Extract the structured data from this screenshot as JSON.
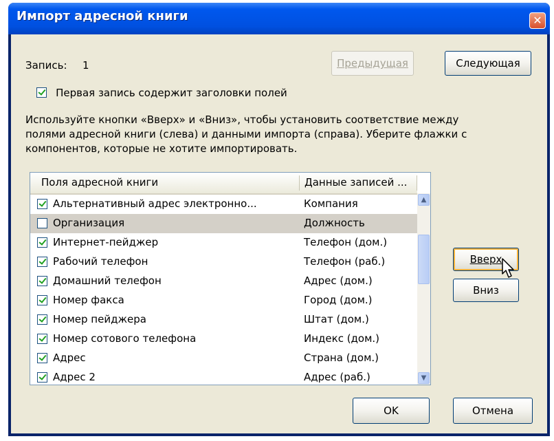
{
  "window": {
    "title": "Импорт адресной книги",
    "close": "✕"
  },
  "record": {
    "label": "Запись:",
    "value": "1"
  },
  "nav": {
    "prev": "Предыдущая",
    "next": "Следующая"
  },
  "first_row": {
    "checked": true,
    "label": "Первая запись содержит заголовки полей"
  },
  "instructions": [
    "Используйте кнопки «Вверх» и «Вниз», чтобы установить соответствие между",
    "полями адресной книги (слева) и данными импорта (справа). Уберите флажки с",
    "компонентов, которые не хотите импортировать."
  ],
  "list": {
    "columns": [
      "Поля адресной книги",
      "Данные записей ..."
    ],
    "rows": [
      {
        "checked": true,
        "field": "Альтернативный адрес электронно...",
        "value": "Компания",
        "selected": false
      },
      {
        "checked": false,
        "field": "Организация",
        "value": "Должность",
        "selected": true
      },
      {
        "checked": true,
        "field": "Интернет-пейджер",
        "value": "Телефон (дом.)",
        "selected": false
      },
      {
        "checked": true,
        "field": "Рабочий телефон",
        "value": "Телефон (раб.)",
        "selected": false
      },
      {
        "checked": true,
        "field": "Домашний телефон",
        "value": "Адрес (дом.)",
        "selected": false
      },
      {
        "checked": true,
        "field": "Номер факса",
        "value": "Город (дом.)",
        "selected": false
      },
      {
        "checked": true,
        "field": "Номер пейджера",
        "value": "Штат (дом.)",
        "selected": false
      },
      {
        "checked": true,
        "field": "Номер сотового телефона",
        "value": "Индекс (дом.)",
        "selected": false
      },
      {
        "checked": true,
        "field": "Адрес",
        "value": "Страна (дом.)",
        "selected": false
      },
      {
        "checked": true,
        "field": "Адрес 2",
        "value": "Адрес (раб.)",
        "selected": false
      }
    ]
  },
  "buttons": {
    "up": "Вверх",
    "down": "Вниз",
    "ok": "OK",
    "cancel": "Отмена"
  },
  "icons": {
    "scroll_up": "scroll-up-arrow-icon",
    "scroll_down": "scroll-down-arrow-icon",
    "cursor": "mouse-pointer-icon"
  }
}
